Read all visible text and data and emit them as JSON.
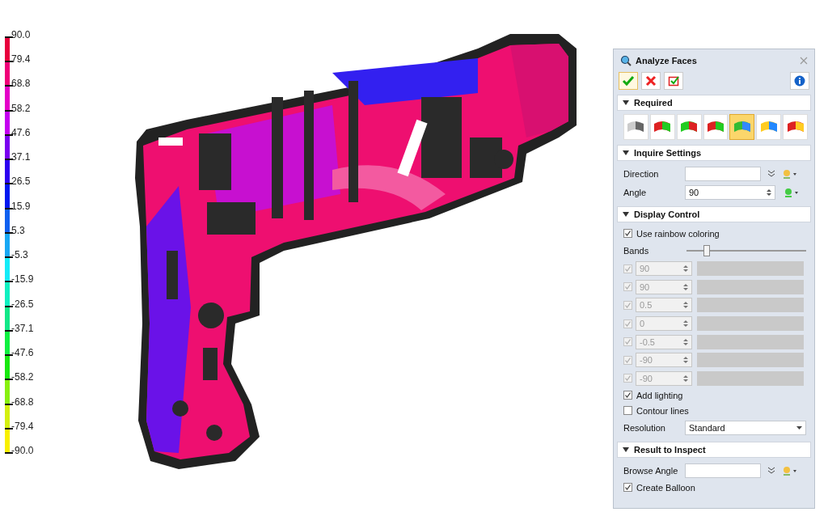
{
  "legend": {
    "ticks": [
      "90.0",
      "79.4",
      "68.8",
      "58.2",
      "47.6",
      "37.1",
      "26.5",
      "15.9",
      "5.3",
      "-5.3",
      "-15.9",
      "-26.5",
      "-37.1",
      "-47.6",
      "-58.2",
      "-68.8",
      "-79.4",
      "-90.0"
    ],
    "bands": [
      {
        "color": "#e8003c"
      },
      {
        "color": "#f00078"
      },
      {
        "color": "#e400c8"
      },
      {
        "color": "#c400f0"
      },
      {
        "color": "#7a00f0"
      },
      {
        "color": "#2c00f0"
      },
      {
        "color": "#0018f0"
      },
      {
        "color": "#1060f0"
      },
      {
        "color": "#18a8f4"
      },
      {
        "color": "#14ecf8"
      },
      {
        "color": "#10f0c0"
      },
      {
        "color": "#12e888"
      },
      {
        "color": "#10f040"
      },
      {
        "color": "#18e810"
      },
      {
        "color": "#88f010"
      },
      {
        "color": "#d4f010"
      },
      {
        "color": "#f8f000"
      }
    ]
  },
  "panel": {
    "title": "Analyze Faces",
    "sections": [
      {
        "kind": "required",
        "title": "Required",
        "expanded": true,
        "face_types": [
          {
            "selected": false
          },
          {
            "selected": false
          },
          {
            "selected": false
          },
          {
            "selected": false
          },
          {
            "selected": true
          },
          {
            "selected": false
          },
          {
            "selected": false
          }
        ]
      },
      {
        "kind": "inquire",
        "title": "Inquire Settings",
        "expanded": true,
        "direction": {
          "label": "Direction"
        },
        "angle": {
          "label": "Angle",
          "value": "90"
        }
      },
      {
        "kind": "display",
        "title": "Display Control",
        "expanded": true,
        "rainbow": {
          "label": "Use rainbow coloring",
          "checked": true
        },
        "bands_label": "Bands",
        "bands_slider": {
          "level": 0.17
        },
        "band_rows": [
          {
            "value": "90",
            "checked": true,
            "disabled": true
          },
          {
            "value": "90",
            "checked": true,
            "disabled": true
          },
          {
            "value": "0.5",
            "checked": true,
            "disabled": true
          },
          {
            "value": "0",
            "checked": true,
            "disabled": true
          },
          {
            "value": "-0.5",
            "checked": true,
            "disabled": true
          },
          {
            "value": "-90",
            "checked": true,
            "disabled": true
          },
          {
            "value": "-90",
            "checked": true,
            "disabled": true
          }
        ],
        "lighting": {
          "label": "Add lighting",
          "checked": true
        },
        "contour": {
          "label": "Contour lines",
          "checked": false
        },
        "resolution": {
          "label": "Resolution",
          "value": "Standard"
        }
      },
      {
        "kind": "result",
        "title": "Result to Inspect",
        "expanded": true,
        "browse": {
          "label": "Browse Angle"
        },
        "balloon": {
          "label": "Create Balloon",
          "checked": true
        }
      }
    ]
  }
}
